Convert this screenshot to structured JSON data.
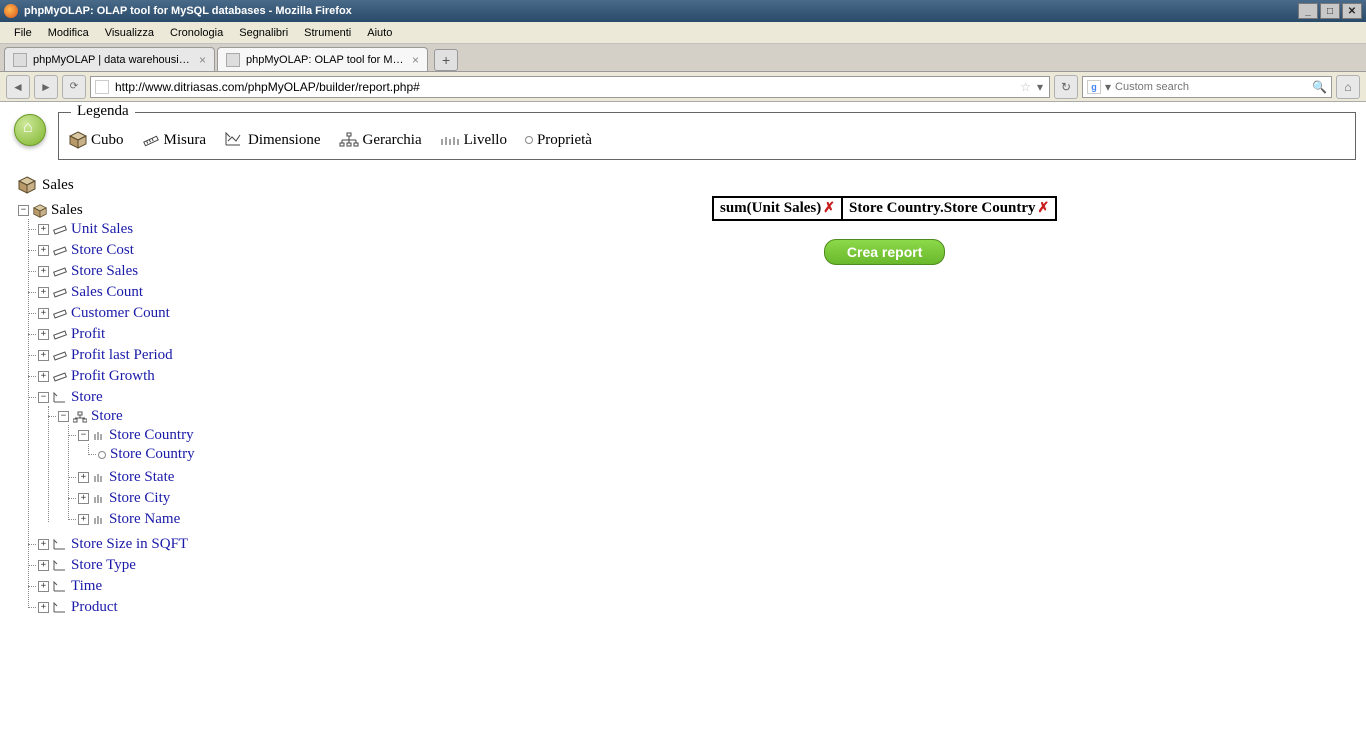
{
  "window": {
    "title": "phpMyOLAP: OLAP tool for MySQL databases - Mozilla Firefox"
  },
  "menu": {
    "items": [
      "File",
      "Modifica",
      "Visualizza",
      "Cronologia",
      "Segnalibri",
      "Strumenti",
      "Aiuto"
    ]
  },
  "tabs": {
    "t0": "phpMyOLAP | data warehousing e analisi …",
    "t1": "phpMyOLAP: OLAP tool for MySQL datab…"
  },
  "url": "http://www.ditriasas.com/phpMyOLAP/builder/report.php#",
  "search_placeholder": "Custom search",
  "legend": {
    "title": "Legenda",
    "cubo": "Cubo",
    "misura": "Misura",
    "dimensione": "Dimensione",
    "gerarchia": "Gerarchia",
    "livello": "Livello",
    "proprieta": "Proprietà"
  },
  "cube_name": "Sales",
  "tree": {
    "root": "Sales",
    "measures": {
      "m0": "Unit Sales",
      "m1": "Store Cost",
      "m2": "Store Sales",
      "m3": "Sales Count",
      "m4": "Customer Count",
      "m5": "Profit",
      "m6": "Profit last Period",
      "m7": "Profit Growth"
    },
    "dim_store": "Store",
    "hier_store": "Store",
    "levels": {
      "l0": "Store Country",
      "l0p": "Store Country",
      "l1": "Store State",
      "l2": "Store City",
      "l3": "Store Name"
    },
    "dim_sqft": "Store Size in SQFT",
    "dim_type": "Store Type",
    "dim_time": "Time",
    "dim_product": "Product"
  },
  "drop": {
    "c0": "sum(Unit Sales)",
    "c1": "Store Country.Store Country"
  },
  "create_label": "Crea report"
}
